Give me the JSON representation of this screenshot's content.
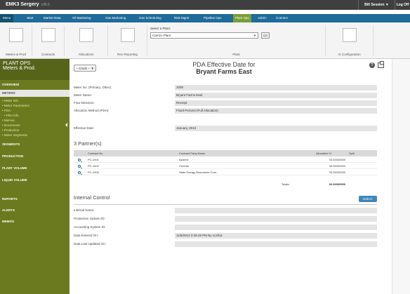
{
  "app": {
    "title": "EMK3 Sergery",
    "version": "v36.0",
    "session": "Bill Session ▼",
    "logoff": "Log Off"
  },
  "nav": [
    "Menu",
    "Start",
    "Market Data",
    "Oil Marketing",
    "Gas Marketing",
    "Gas Scheduling",
    "Risk Mgmt",
    "Pipeline Ops",
    "Plant Ops",
    "Admin",
    "Connect"
  ],
  "toolbar": {
    "buttons": [
      "Meters & Prod",
      "Contracts",
      "Allocations",
      "Rev Reporting"
    ],
    "plant_caption": "Select a Plant:",
    "plant_value": "Carrizo Plant",
    "go_label": "GO",
    "plant_label": "Plant",
    "ai_label": "AI Configuration"
  },
  "sidebar": {
    "heading1": "PLANT OPS",
    "heading2": "Meters & Prod.",
    "overview": "OVERVIEW",
    "meters": "METERS",
    "meter_items": [
      "• Meter Info",
      "• Meter Parameters",
      "• PDA",
      "• PDA Info",
      "• Memos",
      "• Documents",
      "• Production",
      "• Meter Segments"
    ],
    "sections": [
      "SEGMENTS",
      "PRODUCTION",
      "PLANT VOLUME",
      "LIQUID VOLUME"
    ],
    "bottom": [
      "REPORTS",
      "ALERTS",
      "MEMOS"
    ]
  },
  "page": {
    "cmds": "-- Cmds -- ▼",
    "title": "PDA Effective Date for",
    "subtitle": "Bryant Farms East",
    "help": "?"
  },
  "fields": [
    {
      "label": "Meter No. (Primary, Other):",
      "value": "1000"
    },
    {
      "label": "Meter Name:",
      "value": "Bryant Farms East"
    },
    {
      "label": "Flow Direction:",
      "value": "Receipt"
    },
    {
      "label": "Allocation Method (PDA):",
      "value": "Fixed Percent (Full Allocation)"
    }
  ],
  "effective": {
    "label": "Effective Date:",
    "value": "January, 2013"
  },
  "partners": {
    "heading": "3 Partner(s)",
    "columns": [
      "Contract No.",
      "Contract Party Name",
      "Allocation %",
      "Split"
    ],
    "rows": [
      {
        "contract": "PC-1001",
        "party": "Apache",
        "alloc": "33.33333333"
      },
      {
        "contract": "PC-1002",
        "party": "Cenean",
        "alloc": "33.33333333"
      },
      {
        "contract": "PC-1000",
        "party": "State Energy Resources Com...",
        "alloc": "33.33333333"
      }
    ],
    "total_label": "Totals:",
    "total_value": "99.99999999"
  },
  "internal": {
    "heading": "Internal Control",
    "edit": "Edit IC",
    "fields": [
      {
        "label": "Internal Notes:",
        "value": ""
      },
      {
        "label": "Production System ID:",
        "value": ""
      },
      {
        "label": "Accounting System ID:",
        "value": ""
      },
      {
        "label": "Data Entered On:",
        "value": "11/5/2013 3:36:48 PM By sc2011"
      },
      {
        "label": "Data Last Updated On:",
        "value": ""
      }
    ]
  },
  "colors": {
    "nav": "#1f6b9a",
    "sidebar": "#6b7a1e",
    "active_tab": "#7a9e3a",
    "topbar": "#3f3f3f"
  }
}
